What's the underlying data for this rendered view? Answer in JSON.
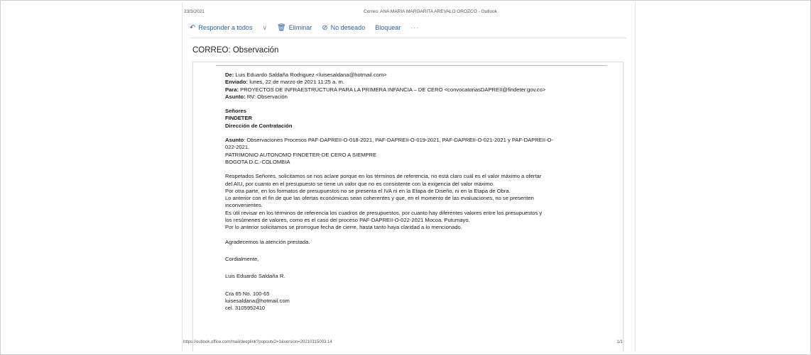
{
  "print": {
    "date": "23/3/2021",
    "title": "Correo: ANA MARIA MARGARITA AREVALO OROZCO - Outlook",
    "url": "https://outlook.office.com/mail/deeplink?popoutv2=1&version=20210315003.14",
    "page": "1/1"
  },
  "toolbar": {
    "reply_all": "Responder a todos",
    "delete": "Eliminar",
    "junk": "No deseado",
    "block": "Bloquear",
    "more": "···"
  },
  "email": {
    "subject": "CORREO: Observación",
    "from_label": "De:",
    "from": "Luis Eduardo Saldaña Rodriguez <luisesaldana@hotmail.com>",
    "sent_label": "Enviado:",
    "sent": "lunes, 22 de marzo de 2021 11:25 a. m.",
    "to_label": "Para:",
    "to": "PROYECTOS DE INFRAESTRUCTURA PARA LA PRIMERA INFANCIA – DE CERO <convocatoriasDAPREII@findeter.gov.co>",
    "re_label": "Asunto:",
    "re": "RV: Observación",
    "addressee": [
      "Señores",
      "FINDETER",
      "Dirección de Contratación"
    ],
    "asunto_label": "Asunto",
    "asunto_text_1": ": Observaciones Procesos PAF-DAPREII-O-018-2021, PAF-DAPREII-O-019-2021, PAF-DAPREII-O-021-2021 y PAF-DAPREII-O-",
    "asunto_text_2": "022-2021.",
    "patrimonio": "PATRIMONIO AUTONOMO FINDETER-DE CERO A SIEMPRE",
    "city": "BOGOTA D.C.-COLOMBIA",
    "body_lines": [
      "Respetados Señores, solicitamos se nos aclare porque en los términos de referencia, no está claro cuál es el valor máximo a ofertar",
      "del AIU, por cuanto en el presupuesto se tiene un valor que no es consistente con la exigencia del valor máximo.",
      "Por otra parte, en los formatos de presupuestos no se presenta el IVA ni en la Etapa de Diseño, ni en la Etapa de Obra.",
      "Lo anterior con el fin de que las ofertas económicas sean coherentes y que, en el momento de las evaluaciones, no se presenten",
      "inconvenientes.",
      "Es útil revisar en los términos de referencia los cuadros de presupuestos, por cuanto hay diferentes valores entre los presupuestos y",
      "los resúmenes de valores, como es el caso del proceso PAF-DAPREII-O-022-2021 Mocoa. Putumayo.",
      "Por lo anterior solicitamos se prorrogue fecha de cierre, hasta tanto haya claridad a lo mencionado."
    ],
    "thanks": "Agradecemos la atención prestada.",
    "closing": "Cordialmente,",
    "signature": "Luis Eduardo Saldaña R.",
    "address": "Cra 65 No. 100-65",
    "email_addr": "luisesaldana@hotmail.com",
    "phone": "cel. 3105952410"
  }
}
